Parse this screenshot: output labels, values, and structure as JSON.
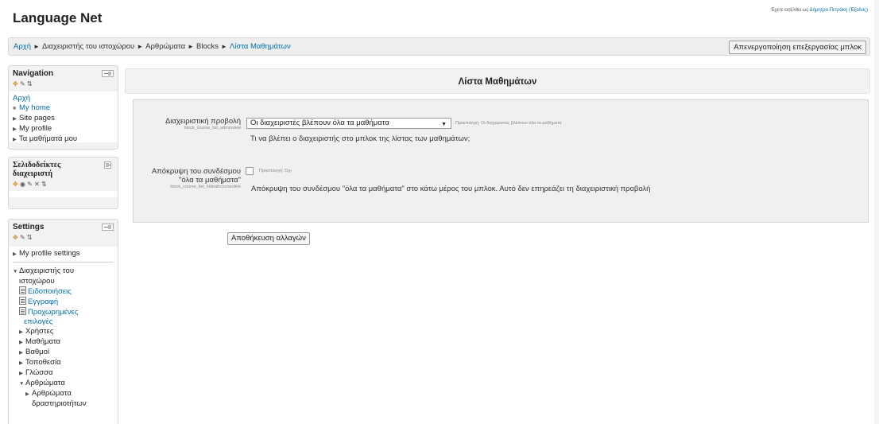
{
  "site": {
    "title": "Language Net",
    "login_prefix": "Έχετε εισέλθει ως ",
    "user_name": "Δήμητρα Πετράκη",
    "logout_label": "(Έξοδος)"
  },
  "breadcrumb": {
    "items": [
      "Αρχή",
      "Διαχειριστής του ιστοχώρου",
      "Αρθρώματα",
      "Blocks",
      "Λίστα Μαθημάτων"
    ],
    "separator": "►"
  },
  "header": {
    "edit_toggle_label": "Απενεργοποίηση επεξεργασίας μπλοκ"
  },
  "navigation_block": {
    "title": "Navigation",
    "root": "Αρχή",
    "items": [
      "My home",
      "Site pages",
      "My profile",
      "Τα μαθήματά μου"
    ]
  },
  "admin_bookmarks_block": {
    "title_line1": "Σελιδοδείκτες",
    "title_line2": "διαχειριστή"
  },
  "settings_block": {
    "title": "Settings",
    "profile_settings": "My profile settings",
    "site_admin_line1": "Διαχειριστής του",
    "site_admin_line2": "ιστοχώρου",
    "notifications": "Ειδοποιήσεις",
    "registration": "Εγγραφή",
    "advanced_line1": "Προχωρημένες",
    "advanced_line2": "επιλογές",
    "users": "Χρήστες",
    "courses": "Μαθήματα",
    "grades": "Βαθμοί",
    "location": "Τοποθεσία",
    "language": "Γλώσσα",
    "plugins": "Αρθρώματα",
    "activity_modules_line1": "Αρθρώματα",
    "activity_modules_line2": "δραστηριοτήτων"
  },
  "main": {
    "title": "Λίστα Μαθημάτων",
    "adminview": {
      "label": "Διαχειριστική προβολή",
      "key": "block_course_list_adminview",
      "value": "Οι διαχειριστές βλέπουν όλα τα μαθήματα",
      "default": "Προεπιλογή: Οι διαχειριστές βλέπουν όλα τα μαθήματα",
      "description": "Τι να βλέπει ο διαχειριστής στο μπλοκ της λίστας των μαθημάτων;"
    },
    "hidelink": {
      "label_line1": "Απόκρυψη του συνδέσμου",
      "label_line2": "\"όλα τα μαθήματα\"",
      "key": "block_course_list_hideallcourseslink",
      "checked": false,
      "default": "Προεπιλογή: Όχι",
      "description": "Απόκρυψη του συνδέσμου \"όλα τα μαθήματα\" στο κάτω μέρος του μπλοκ. Αυτό δεν επηρεάζει τη διαχειριστική προβολή"
    },
    "save_label": "Αποθήκευση αλλαγών"
  }
}
